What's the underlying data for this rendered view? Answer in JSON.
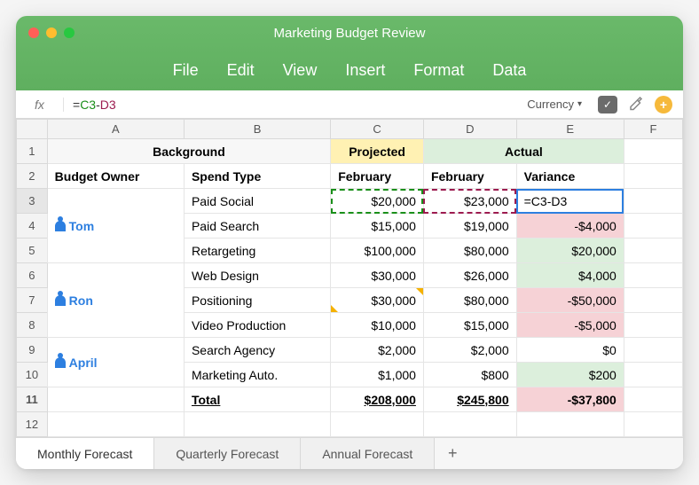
{
  "window": {
    "title": "Marketing Budget Review"
  },
  "menu": {
    "file": "File",
    "edit": "Edit",
    "view": "View",
    "insert": "Insert",
    "format": "Format",
    "data": "Data"
  },
  "formula": {
    "fx": "fx",
    "eq": "=",
    "ref1": "C3",
    "op": "-",
    "ref2": "D3"
  },
  "tools": {
    "currency_label": "Currency",
    "check": "✓",
    "brush": "✎",
    "plus": "+"
  },
  "columns": {
    "a": "A",
    "b": "B",
    "c": "C",
    "d": "D",
    "e": "E",
    "f": "F"
  },
  "row_nums": [
    "1",
    "2",
    "3",
    "4",
    "5",
    "6",
    "7",
    "8",
    "9",
    "10",
    "11",
    "12"
  ],
  "headers": {
    "background": "Background",
    "projected": "Projected",
    "actual": "Actual",
    "budget_owner": "Budget Owner",
    "spend_type": "Spend Type",
    "feb1": "February",
    "feb2": "February",
    "variance": "Variance"
  },
  "owners": {
    "tom": "Tom",
    "ron": "Ron",
    "april": "April"
  },
  "rows": [
    {
      "type": "Paid Social",
      "proj": "$20,000",
      "act": "$23,000",
      "var": "=C3-D3",
      "neg": false,
      "active": true
    },
    {
      "type": "Paid Search",
      "proj": "$15,000",
      "act": "$19,000",
      "var": "-$4,000",
      "neg": true
    },
    {
      "type": "Retargeting",
      "proj": "$100,000",
      "act": "$80,000",
      "var": "$20,000",
      "neg": false
    },
    {
      "type": "Web Design",
      "proj": "$30,000",
      "act": "$26,000",
      "var": "$4,000",
      "neg": false
    },
    {
      "type": "Positioning",
      "proj": "$30,000",
      "act": "$80,000",
      "var": "-$50,000",
      "neg": true
    },
    {
      "type": "Video Production",
      "proj": "$10,000",
      "act": "$15,000",
      "var": "-$5,000",
      "neg": true
    },
    {
      "type": "Search Agency",
      "proj": "$2,000",
      "act": "$2,000",
      "var": "$0",
      "neg": false,
      "neutral": true
    },
    {
      "type": "Marketing Auto.",
      "proj": "$1,000",
      "act": "$800",
      "var": "$200",
      "neg": false
    }
  ],
  "totals": {
    "label": "Total",
    "proj": "$208,000",
    "act": "$245,800",
    "var": "-$37,800"
  },
  "tabs": {
    "monthly": "Monthly Forecast",
    "quarterly": "Quarterly Forecast",
    "annual": "Annual Forecast",
    "add": "+"
  }
}
